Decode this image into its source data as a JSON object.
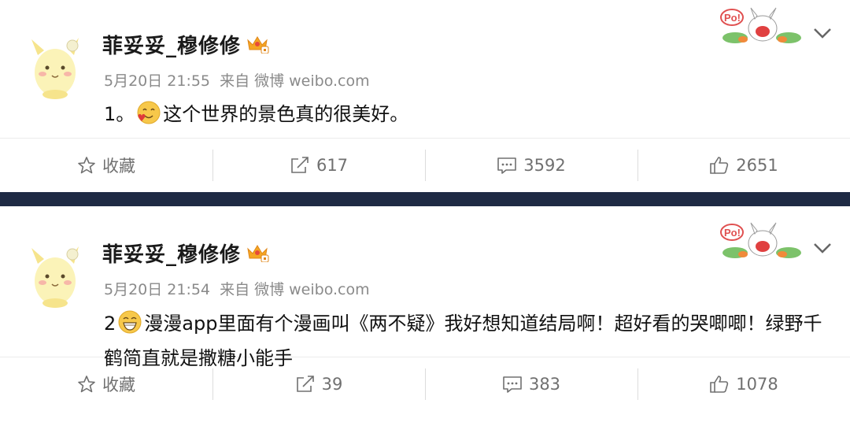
{
  "posts": [
    {
      "username": "菲妥妥_穆修修",
      "date": "5月20日",
      "time": "21:55",
      "source_prefix": "来自",
      "source": "微博 weibo.com",
      "content_prefix": "1。",
      "content_text": "这个世界的景色真的很美好。",
      "actions": {
        "favorite": "收藏",
        "repost": "617",
        "comment": "3592",
        "like": "2651"
      }
    },
    {
      "username": "菲妥妥_穆修修",
      "date": "5月20日",
      "time": "21:54",
      "source_prefix": "来自",
      "source": "微博 weibo.com",
      "content_prefix": "2",
      "content_text": "漫漫app里面有个漫画叫《两不疑》我好想知道结局啊！超好看的哭唧唧！绿野千鹤简直就是撒糖小能手",
      "actions": {
        "favorite": "收藏",
        "repost": "39",
        "comment": "383",
        "like": "1078"
      }
    }
  ],
  "sticker_text": "Po!",
  "colors": {
    "divider": "#1e2a44",
    "meta": "#8a8a8a",
    "action": "#707070",
    "crown": "#f5a623"
  }
}
